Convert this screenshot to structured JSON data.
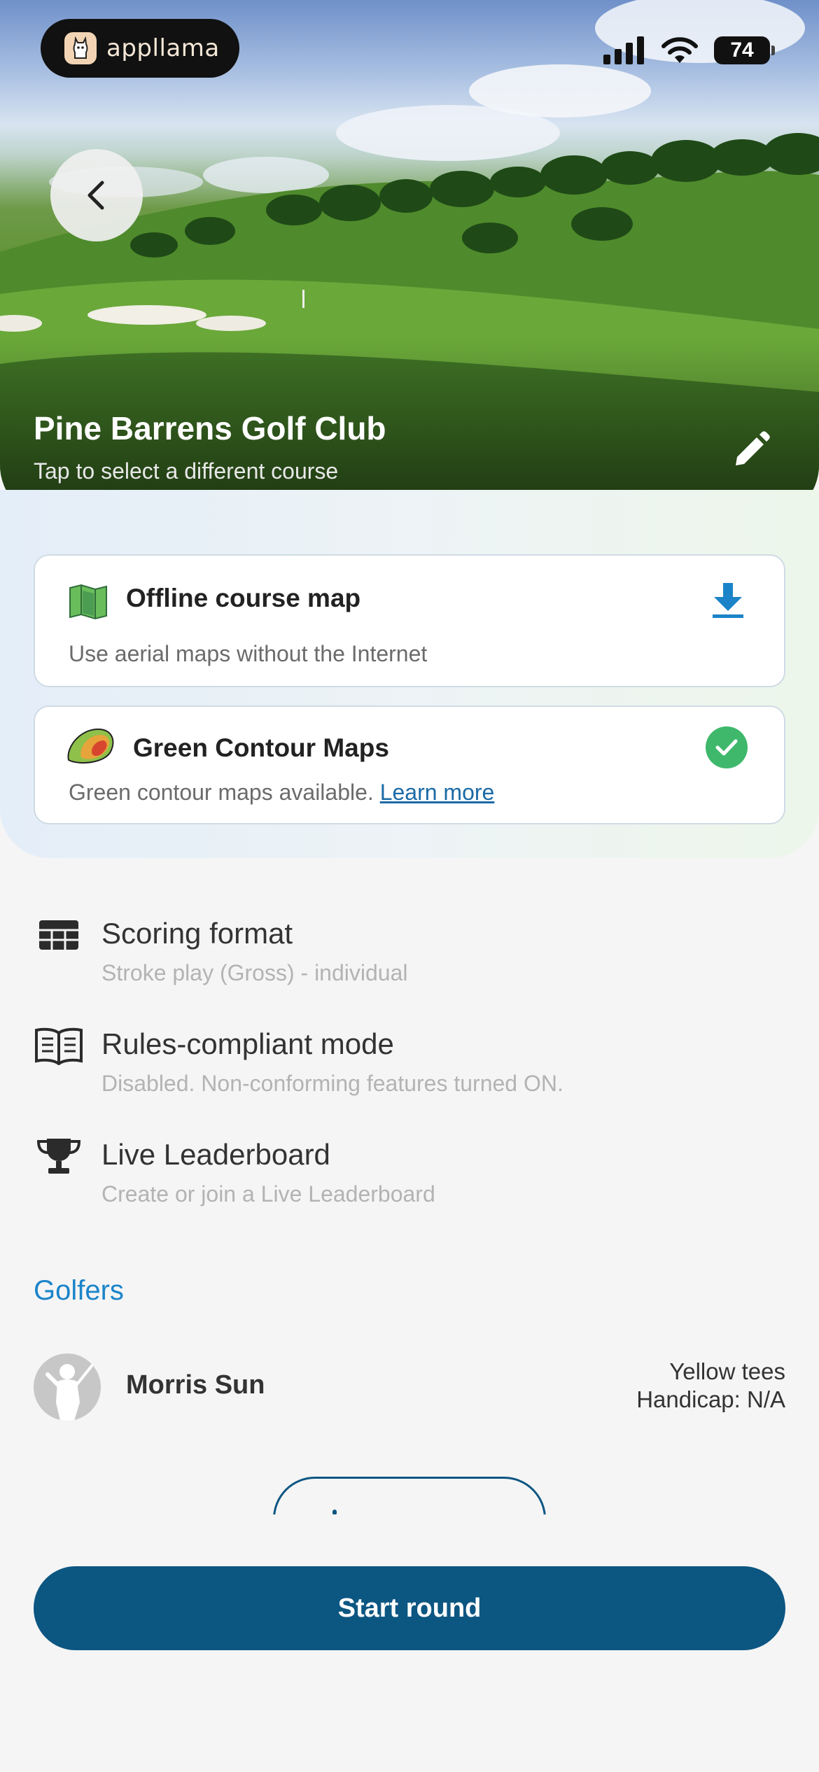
{
  "status_bar": {
    "battery": "74"
  },
  "brand": {
    "name": "appllama",
    "icon": "llama-icon"
  },
  "course": {
    "name": "Pine Barrens Golf Club",
    "subtitle": "Tap to select a different course"
  },
  "cards": {
    "offline_map": {
      "title": "Offline course map",
      "description": "Use aerial maps without the Internet",
      "icon": "folded-map-icon",
      "action_icon": "download-icon"
    },
    "green_contour": {
      "title": "Green Contour Maps",
      "description": "Green contour maps available.",
      "link": "Learn more",
      "icon": "contour-map-icon",
      "status_icon": "check-circle-icon"
    }
  },
  "settings": [
    {
      "title": "Scoring format",
      "subtitle": "Stroke play (Gross) - individual",
      "icon": "table-icon"
    },
    {
      "title": "Rules-compliant mode",
      "subtitle": "Disabled. Non-conforming features turned ON.",
      "icon": "book-icon"
    },
    {
      "title": "Live Leaderboard",
      "subtitle": "Create or join a Live Leaderboard",
      "icon": "trophy-icon"
    }
  ],
  "golfers": {
    "section_title": "Golfers",
    "list": [
      {
        "name": "Morris Sun",
        "tees": "Yellow tees",
        "handicap": "Handicap: N/A"
      }
    ]
  },
  "actions": {
    "start_round": "Start round"
  },
  "colors": {
    "primary": "#0c5682",
    "accent_blue": "#1b84c9",
    "download_blue": "#1b84c9",
    "check_green": "#3fb86b"
  }
}
